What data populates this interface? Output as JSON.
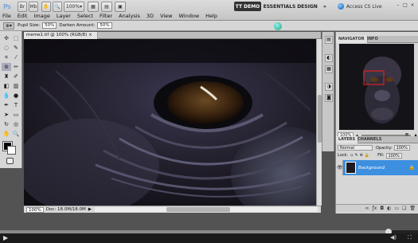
{
  "app": {
    "logo": "Ps",
    "zoom_select": "100%"
  },
  "menu": [
    "File",
    "Edit",
    "Image",
    "Layer",
    "Select",
    "Filter",
    "Analysis",
    "3D",
    "View",
    "Window",
    "Help"
  ],
  "workspaces": {
    "active": "TT DEMO",
    "items": [
      "ESSENTIALS",
      "DESIGN"
    ],
    "more": "»"
  },
  "cs_live": "Access CS Live",
  "window_controls": [
    "–",
    "□",
    "×"
  ],
  "options_bar": {
    "pupil_label": "Pupil Size:",
    "pupil_value": "50%",
    "darken_label": "Darken Amount:",
    "darken_value": "50%"
  },
  "document": {
    "tab_title": "meme1.tif @ 100% (RGB/8)",
    "tab_close": "×",
    "status_zoom": "100%",
    "status_doc": "Doc: 18.0M/18.0M",
    "status_arrow": "▶"
  },
  "panels": {
    "navigator_tabs": [
      "NAVIGATOR",
      "INFO"
    ],
    "navigator_zoom": "100%",
    "layers_tabs": [
      "LAYERS",
      "CHANNELS"
    ],
    "blend_mode": "Normal",
    "opacity_label": "Opacity:",
    "opacity_value": "100%",
    "lock_label": "Lock:",
    "fill_label": "Fill:",
    "fill_value": "100%",
    "layer_name": "Background"
  },
  "video": {
    "progress": 0.93
  }
}
